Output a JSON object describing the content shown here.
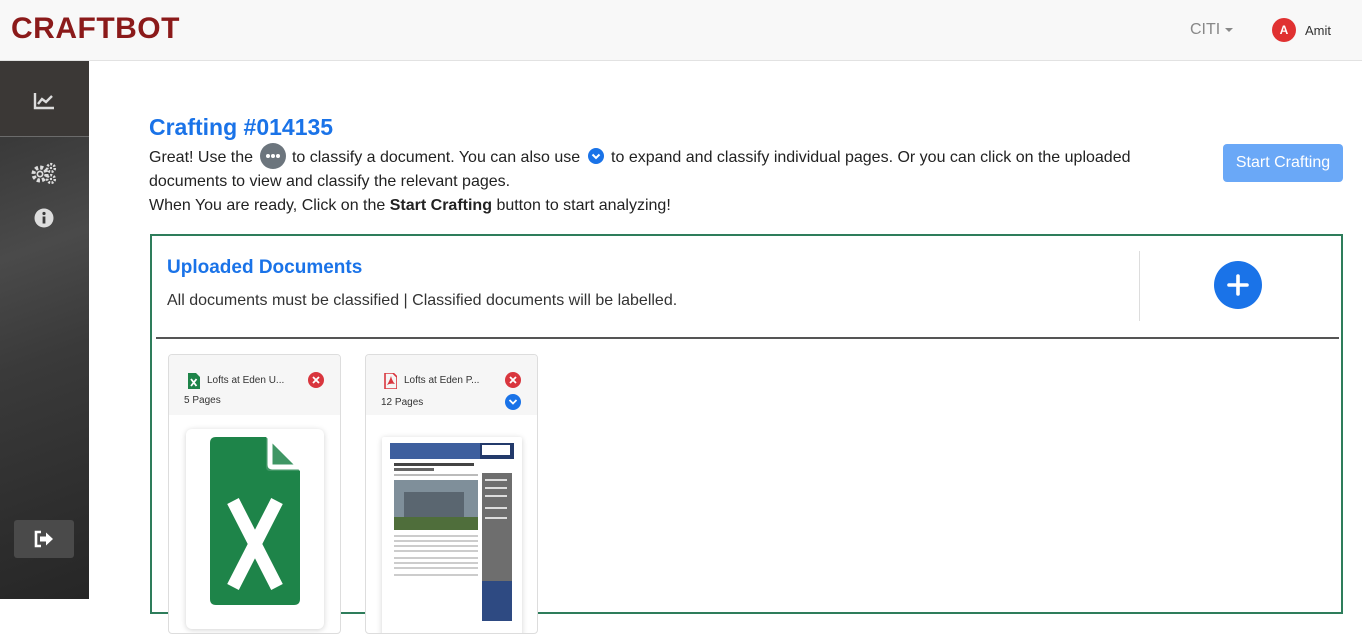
{
  "header": {
    "brand": "CRAFTBOT",
    "org": "CITI",
    "user_initial": "A",
    "user_name": "Amit"
  },
  "sidebar": {
    "items": [
      {
        "icon": "chart-line-icon"
      },
      {
        "icon": "cogs-icon"
      },
      {
        "icon": "info-icon"
      },
      {
        "icon": "sign-out-icon"
      }
    ]
  },
  "main": {
    "title": "Crafting #014135",
    "intro": {
      "part1": "Great! Use the",
      "part2": "to classify a document. You can also use",
      "part3": "to expand and classify individual pages. Or you can click on the uploaded documents to view and classify the relevant pages.",
      "line2_prefix": "When You are ready, Click on the",
      "line2_bold": "Start Crafting",
      "line2_suffix": "button to start analyzing!"
    },
    "start_button": "Start Crafting"
  },
  "uploaded": {
    "title": "Uploaded Documents",
    "subtitle": "All documents must be classified | Classified documents will be labelled.",
    "documents": [
      {
        "name": "Lofts at Eden U...",
        "pages": "5 Pages",
        "type": "excel"
      },
      {
        "name": "Lofts at Eden P...",
        "pages": "12 Pages",
        "type": "pdf"
      }
    ]
  },
  "colors": {
    "brand": "#8b1a1a",
    "accent": "#1a73e8",
    "panel_border": "#2e7d5b",
    "excel_green": "#1e8449",
    "danger": "#d9363e"
  }
}
